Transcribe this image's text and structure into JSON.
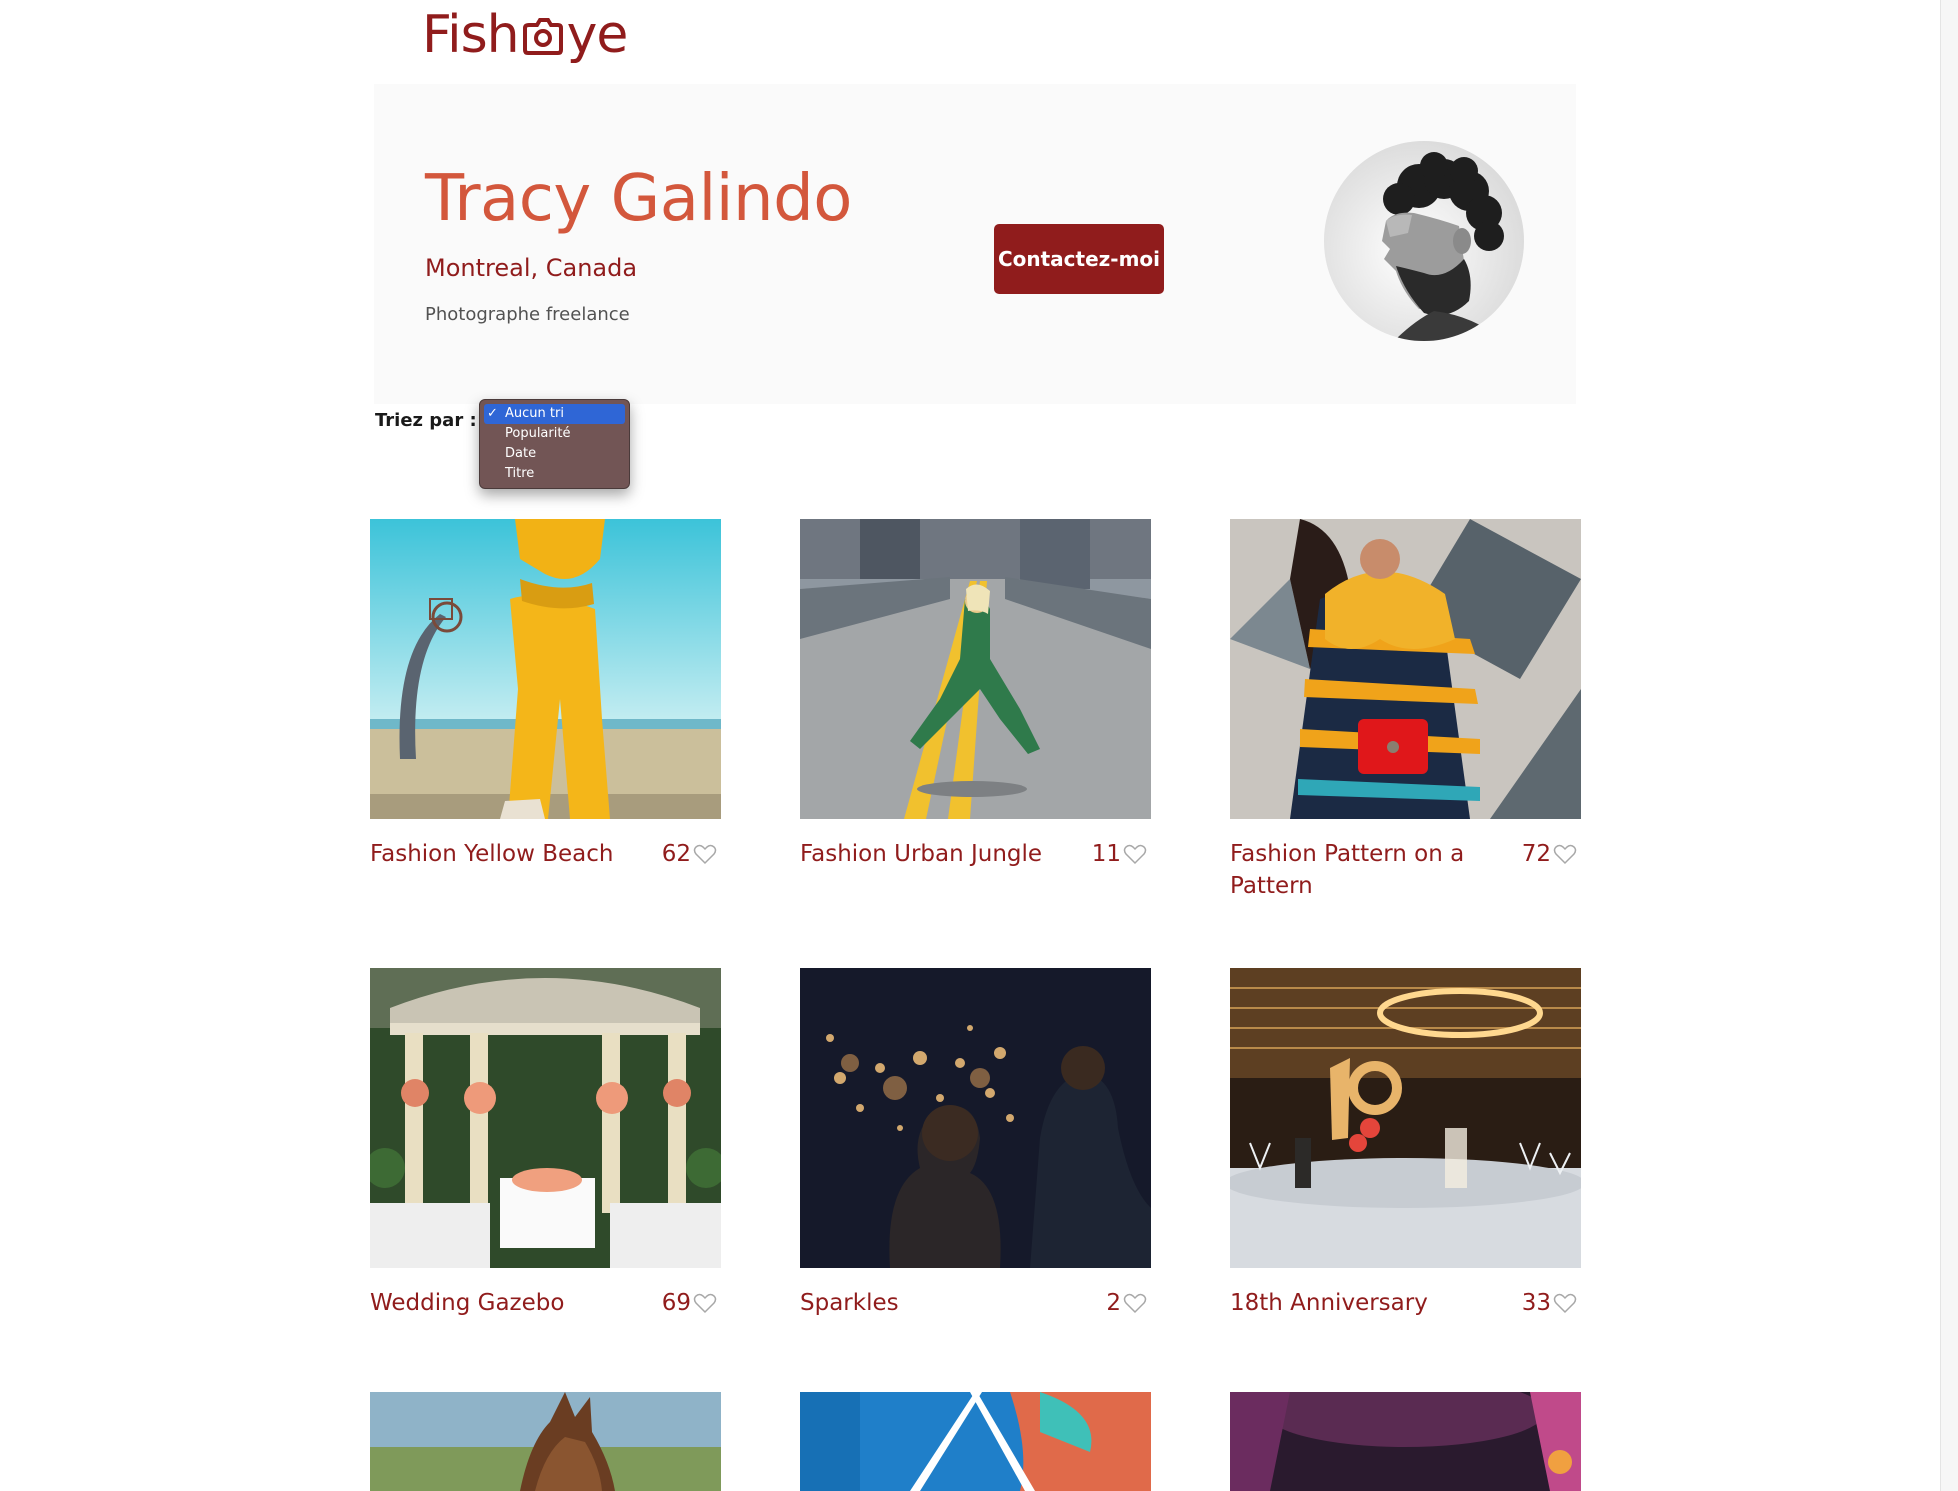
{
  "header": {
    "logo_text_left": "Fish",
    "logo_text_right": "ye"
  },
  "photographer": {
    "name": "Tracy Galindo",
    "location": "Montreal, Canada",
    "tagline": "Photographe freelance",
    "contact_label": "Contactez-moi",
    "portrait_icon": "portrait-photo"
  },
  "sort": {
    "label": "Triez par :",
    "options": [
      "Aucun tri",
      "Popularité",
      "Date",
      "Titre"
    ],
    "selected": "Aucun tri",
    "check_mark": "✓"
  },
  "gallery": [
    {
      "title": "Fashion Yellow Beach",
      "likes": "62"
    },
    {
      "title": "Fashion Urban Jungle",
      "likes": "11"
    },
    {
      "title": "Fashion Pattern on a Pattern",
      "likes": "72"
    },
    {
      "title": "Wedding Gazebo",
      "likes": "69"
    },
    {
      "title": "Sparkles",
      "likes": "2"
    },
    {
      "title": "18th Anniversary",
      "likes": "33"
    },
    {
      "title": "",
      "likes": ""
    },
    {
      "title": "",
      "likes": ""
    },
    {
      "title": "",
      "likes": ""
    }
  ],
  "colors": {
    "brand": "#901C1C",
    "name_accent": "#D3573C",
    "banner_bg": "#FAFAFA",
    "menu_highlight": "#2F66D6"
  }
}
